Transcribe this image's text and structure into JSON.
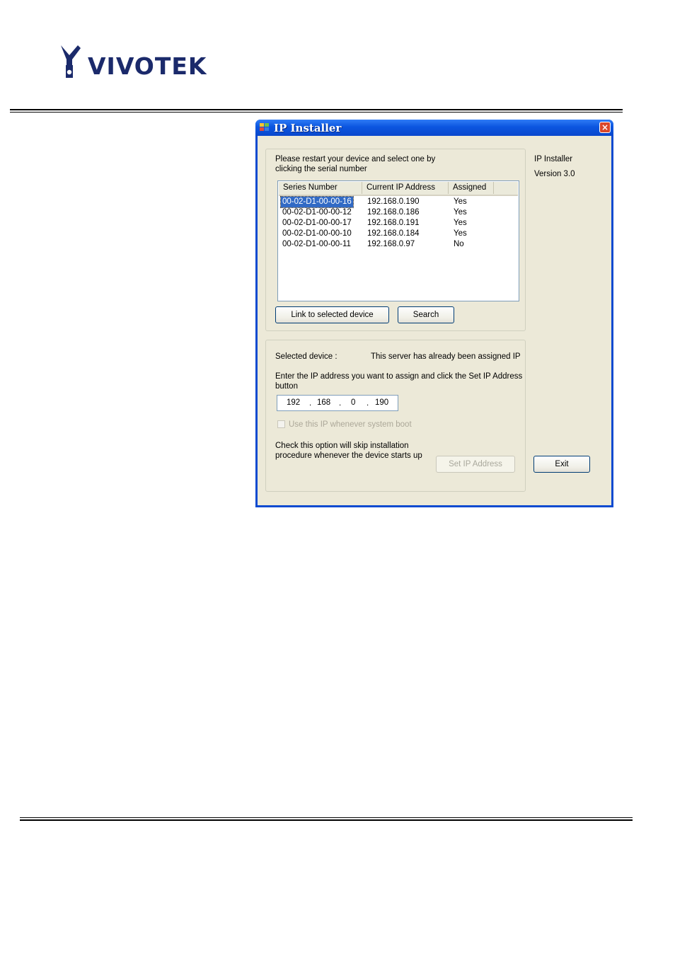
{
  "logo": {
    "text": "VIVOTEK",
    "icon": "camera-logo-icon",
    "color": "#1b2a6b"
  },
  "window": {
    "title": "IP Installer",
    "title_icon": "app-icon",
    "close_icon": "close-icon",
    "close_glyph": "×",
    "titlebar_color": "#0a55e0",
    "instruction_line1": "Please restart your device and select one by",
    "instruction_line2": "clicking the serial number",
    "about_name": "IP Installer",
    "about_version": "Version 3.0",
    "list": {
      "columns": [
        "Series Number",
        "Current IP Address",
        "Assigned"
      ],
      "rows": [
        [
          "00-02-D1-00-00-16",
          "192.168.0.190",
          "Yes"
        ],
        [
          "00-02-D1-00-00-12",
          "192.168.0.186",
          "Yes"
        ],
        [
          "00-02-D1-00-00-17",
          "192.168.0.191",
          "Yes"
        ],
        [
          "00-02-D1-00-00-10",
          "192.168.0.184",
          "Yes"
        ],
        [
          "00-02-D1-00-00-11",
          "192.168.0.97",
          "No"
        ]
      ],
      "selected_row": 0,
      "selection_color": "#316ac5"
    },
    "link_button": "Link to selected device",
    "search_button": "Search",
    "selected_device_label": "Selected device :",
    "selected_device_status": "This server has already been assigned IP",
    "enter_ip_line1": "Enter the IP address you want to assign and click the Set IP Address",
    "enter_ip_line2": "button",
    "ip_octets": [
      "192",
      "168",
      "0",
      "190"
    ],
    "checkbox_label": "Use this IP whenever system boot",
    "checkbox_checked": false,
    "skip_note_line1": "Check this option will skip installation",
    "skip_note_line2": "procedure whenever the device starts up",
    "set_ip_button": "Set IP Address",
    "exit_button": "Exit"
  }
}
